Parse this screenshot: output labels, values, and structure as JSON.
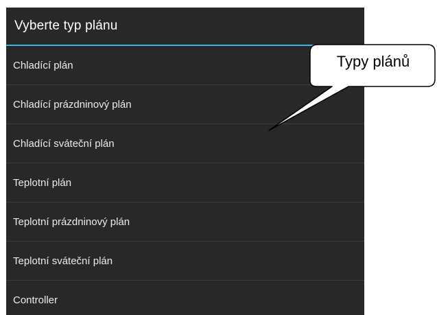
{
  "dialog": {
    "title": "Vyberte typ plánu",
    "accent_color": "#33b5e5",
    "background_color": "#282828",
    "items": [
      {
        "label": "Chladící plán"
      },
      {
        "label": "Chladící prázdninový plán"
      },
      {
        "label": "Chladící sváteční plán"
      },
      {
        "label": "Teplotní plán"
      },
      {
        "label": "Teplotní prázdninový plán"
      },
      {
        "label": "Teplotní sváteční plán"
      },
      {
        "label": "Controller"
      }
    ]
  },
  "callout": {
    "text": "Typy plánů"
  }
}
